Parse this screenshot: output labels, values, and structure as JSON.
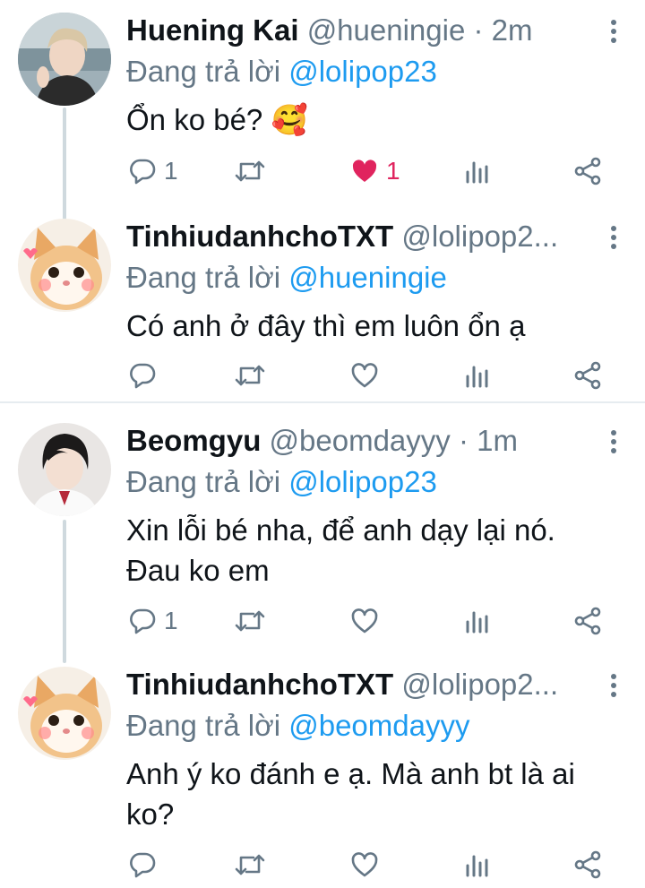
{
  "tweets": [
    {
      "name": "Huening Kai",
      "handle": "@hueningie · 2m",
      "replying_prefix": "Đang trả lời ",
      "replying_to": "@lolipop23",
      "text": "Ổn ko bé? 🥰",
      "reply_count": "1",
      "retweet_count": "",
      "like_count": "1",
      "liked": true,
      "avatar": "boy-photo-avatar"
    },
    {
      "name": "TinhiudanhchoTXT",
      "handle": "@lolipop2...",
      "replying_prefix": "Đang trả lời ",
      "replying_to": "@hueningie",
      "text": "Có anh ở đây thì em luôn ổn ạ",
      "reply_count": "",
      "retweet_count": "",
      "like_count": "",
      "liked": false,
      "avatar": "cat-avatar"
    },
    {
      "name": "Beomgyu",
      "handle": "@beomdayyy · 1m",
      "replying_prefix": "Đang trả lời ",
      "replying_to": "@lolipop23",
      "text": "Xin lỗi bé nha, để anh dạy lại nó. Đau ko em",
      "reply_count": "1",
      "retweet_count": "",
      "like_count": "",
      "liked": false,
      "avatar": "boy-photo-avatar"
    },
    {
      "name": "TinhiudanhchoTXT",
      "handle": "@lolipop2...",
      "replying_prefix": "Đang trả lời ",
      "replying_to": "@beomdayyy",
      "text": "Anh ý ko đánh e ạ. Mà anh bt là ai ko?",
      "reply_count": "",
      "retweet_count": "",
      "like_count": "",
      "liked": false,
      "avatar": "cat-avatar"
    }
  ],
  "colors": {
    "accent": "#1d9bf0",
    "muted": "#657786",
    "like": "#e0245e",
    "thread": "#cfd9de"
  },
  "icons": [
    "reply-icon",
    "retweet-icon",
    "like-icon",
    "analytics-icon",
    "share-icon",
    "more-icon"
  ]
}
